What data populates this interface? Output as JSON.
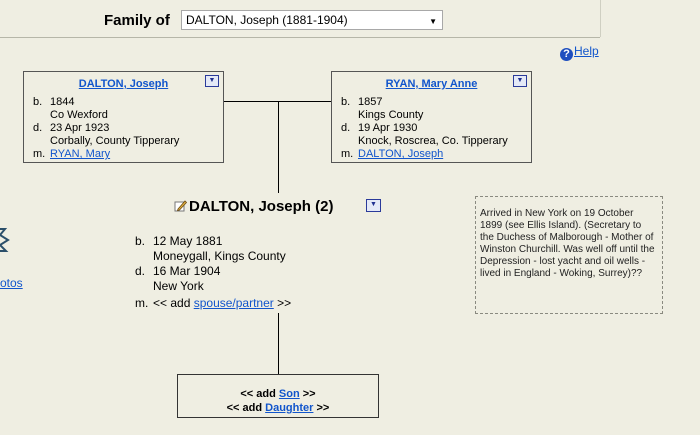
{
  "header": {
    "family_label": "Family of",
    "family_select_value": "DALTON, Joseph (1881-1904)"
  },
  "help": {
    "label": "Help"
  },
  "father": {
    "name": "DALTON, Joseph",
    "birth_key": "b.",
    "birth_date": "1844",
    "birth_place": "Co Wexford",
    "death_key": "d.",
    "death_date": "23 Apr 1923",
    "death_place": "Corbally, County Tipperary",
    "marriage_key": "m.",
    "spouse": "RYAN, Mary"
  },
  "mother": {
    "name": "RYAN, Mary Anne",
    "birth_key": "b.",
    "birth_date": "1857",
    "birth_place": "Kings County",
    "death_key": "d.",
    "death_date": "19 Apr 1930",
    "death_place": "Knock, Roscrea, Co. Tipperary",
    "marriage_key": "m.",
    "spouse": "DALTON, Joseph"
  },
  "subject": {
    "name": "DALTON, Joseph (2)",
    "birth_key": "b.",
    "birth_date": "12 May 1881",
    "birth_place": "Moneygall, Kings County",
    "death_key": "d.",
    "death_date": "16 Mar 1904",
    "death_place": "New York",
    "marriage_key": "m.",
    "add_prefix": "<< add",
    "add_spouse_link": "spouse/partner",
    "add_suffix": ">>"
  },
  "notes": {
    "text": "Arrived in New York on 19 October 1899 (see Ellis Island). (Secretary to the Duchess of Malborough - Mother of Winston Churchill. Was well off until the Depression - lost yacht and oil wells - lived in England - Woking, Surrey)??"
  },
  "children": {
    "prefix": "<< add",
    "son_link": "Son",
    "daughter_link": "Daughter",
    "suffix": ">>"
  },
  "left_edge": {
    "link_text": "otos"
  },
  "colors": {
    "background": "#efeee2",
    "link": "#1155cc",
    "help_icon": "#1f4fbf"
  }
}
